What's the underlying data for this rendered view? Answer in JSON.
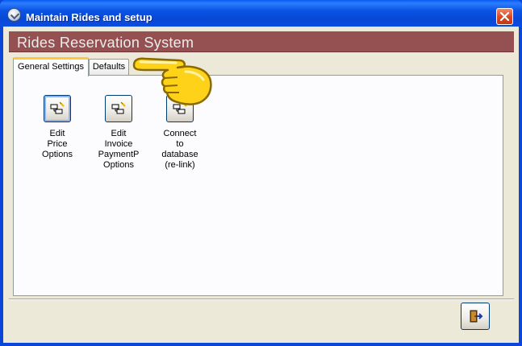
{
  "window": {
    "title": "Maintain Rides and setup",
    "close_label": "Close",
    "icon": "checkmark-app-icon"
  },
  "header": {
    "title": "Rides Reservation System"
  },
  "tabs": [
    {
      "label": "General Settings",
      "active": true
    },
    {
      "label": "Defaults",
      "active": false
    }
  ],
  "commands": [
    {
      "icon": "edit-form-icon",
      "lines": [
        "Edit",
        "Price",
        "Options"
      ]
    },
    {
      "icon": "edit-form-icon",
      "lines": [
        "Edit",
        "Invoice",
        "PaymentP",
        "Options"
      ]
    },
    {
      "icon": "edit-form-icon",
      "lines": [
        "Connect",
        "to",
        "database",
        "(re-link)"
      ]
    }
  ],
  "footer": {
    "exit_icon": "exit-door-icon"
  },
  "annotation": {
    "icon": "pointing-hand-icon"
  },
  "colors": {
    "title_bar": "#0a54e3",
    "header_band": "#955152",
    "header_text": "#ededed",
    "active_tab_accent": "#ffc83c",
    "window_body": "#ece9d8"
  }
}
